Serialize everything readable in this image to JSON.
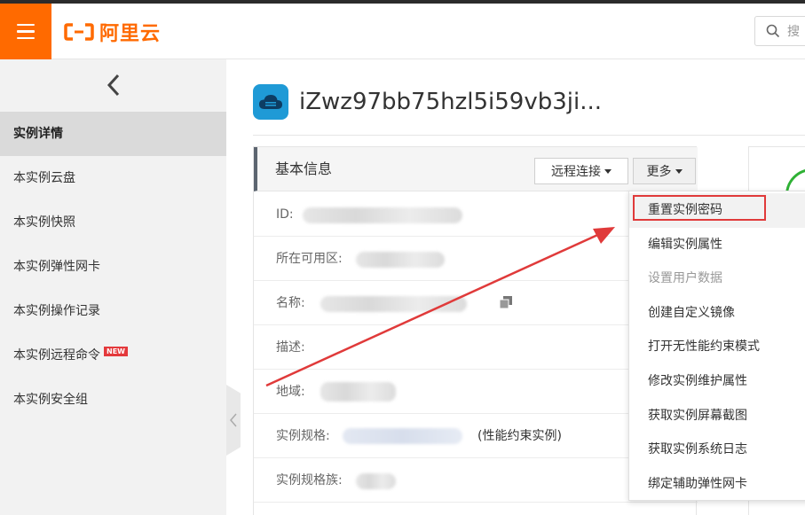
{
  "header": {
    "brand": "阿里云",
    "search_placeholder": "搜"
  },
  "sidebar": {
    "items": [
      {
        "label": "实例详情",
        "active": true
      },
      {
        "label": "本实例云盘"
      },
      {
        "label": "本实例快照"
      },
      {
        "label": "本实例弹性网卡"
      },
      {
        "label": "本实例操作记录"
      },
      {
        "label": "本实例远程命令",
        "badge": "NEW"
      },
      {
        "label": "本实例安全组"
      }
    ]
  },
  "instance": {
    "title": "iZwz97bb75hzl5i59vb3ji..."
  },
  "panel": {
    "title": "基本信息",
    "remote_label": "远程连接",
    "more_label": "更多",
    "rows": [
      {
        "label": "ID:"
      },
      {
        "label": "所在可用区:"
      },
      {
        "label": "名称:"
      },
      {
        "label": "描述:"
      },
      {
        "label": "地域:"
      },
      {
        "label": "实例规格:",
        "note": "(性能约束实例)"
      },
      {
        "label": "实例规格族:"
      }
    ]
  },
  "dropdown": {
    "items": [
      {
        "label": "重置实例密码",
        "highlighted": true
      },
      {
        "label": "编辑实例属性"
      },
      {
        "label": "设置用户数据",
        "disabled": true
      },
      {
        "label": "创建自定义镜像"
      },
      {
        "label": "打开无性能约束模式"
      },
      {
        "label": "修改实例维护属性"
      },
      {
        "label": "获取实例屏幕截图"
      },
      {
        "label": "获取实例系统日志"
      },
      {
        "label": "绑定辅助弹性网卡"
      }
    ]
  },
  "colors": {
    "brand": "#ff6a00",
    "annotation": "#e03a3a",
    "instance_icon": "#1f9ad6",
    "status": "#2fb135"
  }
}
